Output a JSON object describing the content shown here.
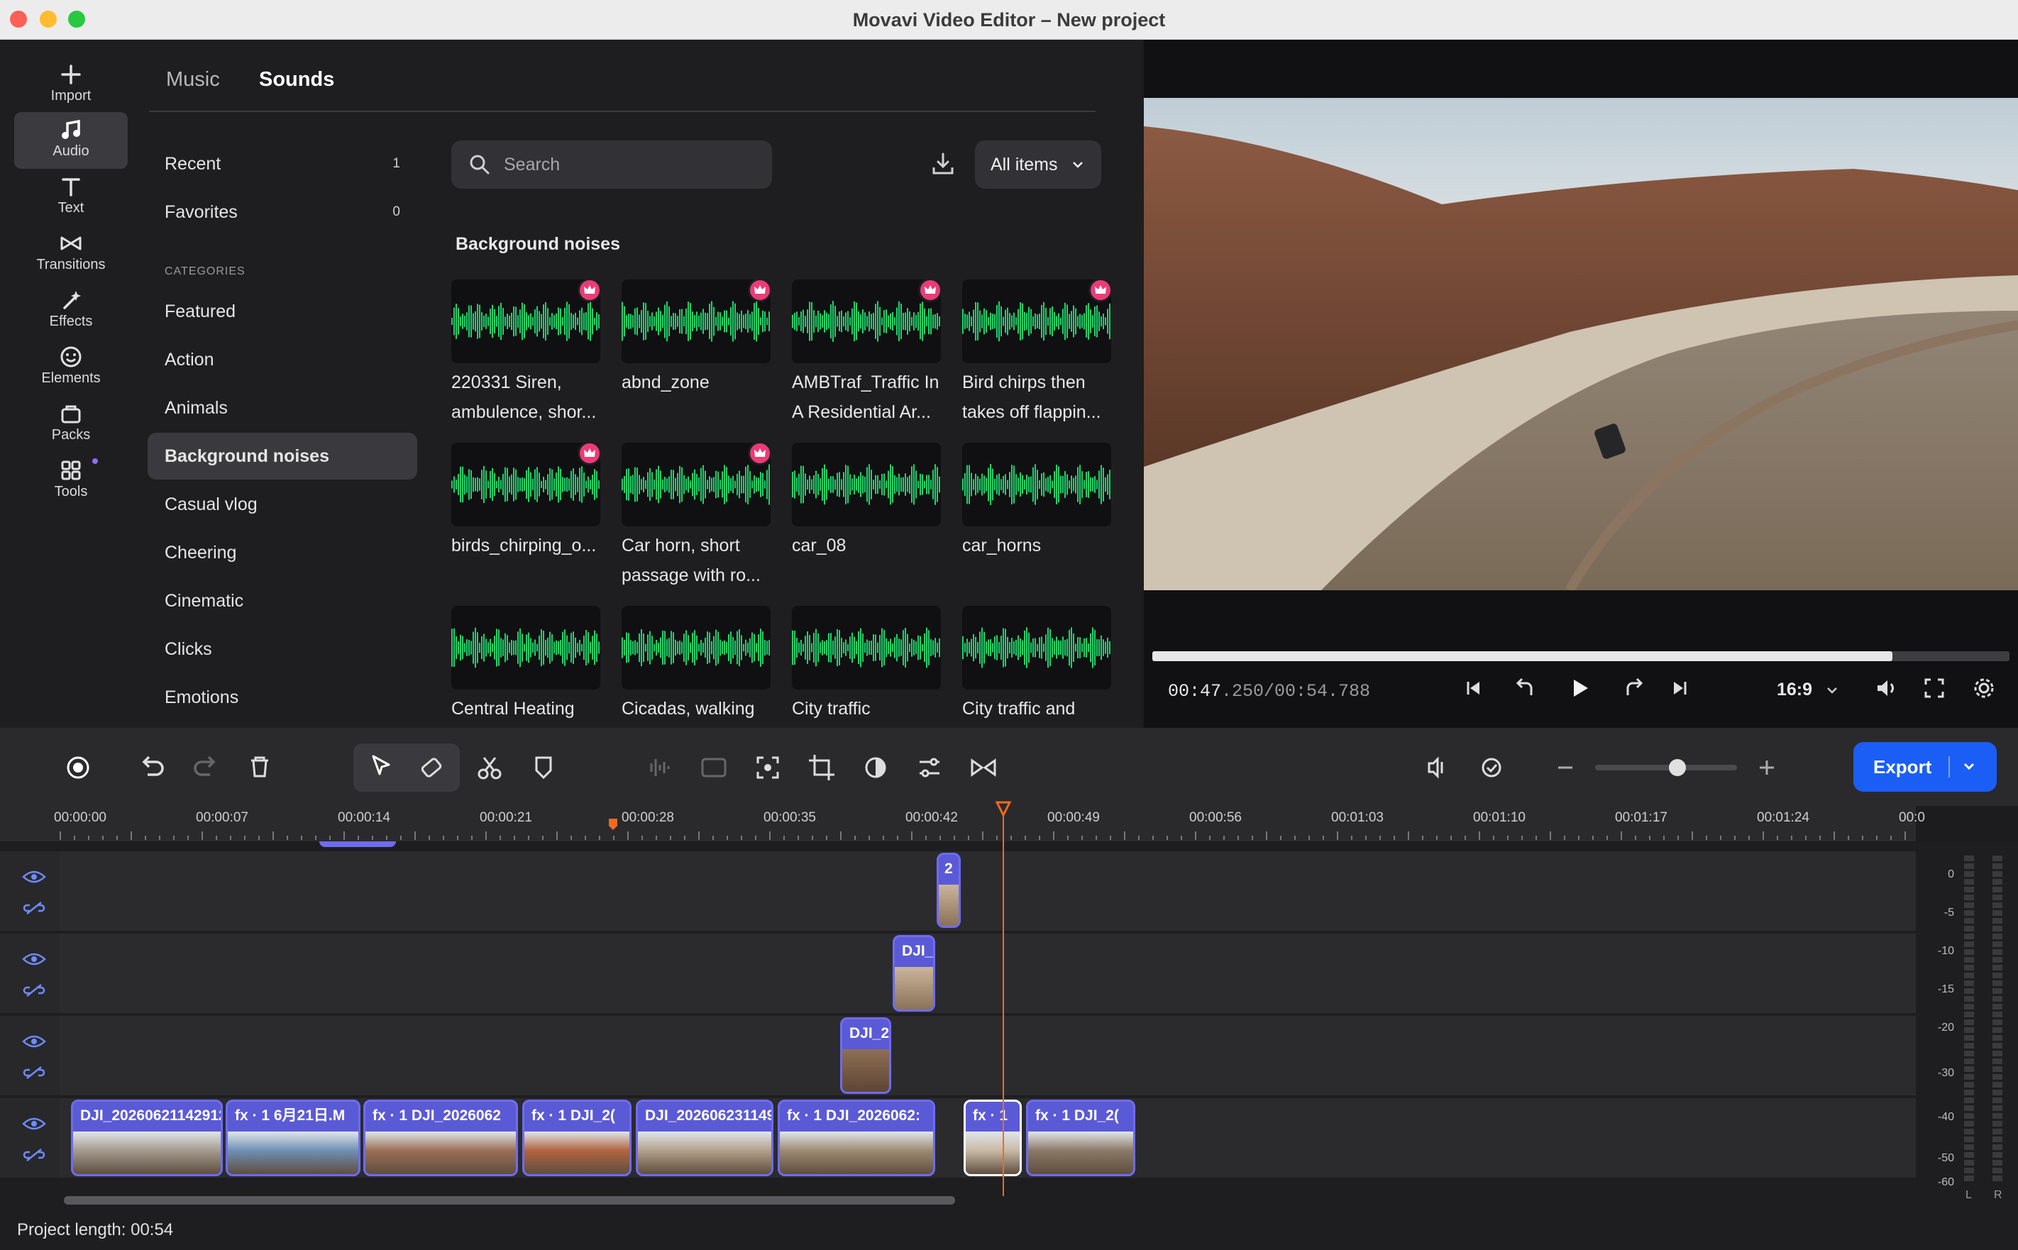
{
  "window": {
    "title": "Movavi Video Editor – New project"
  },
  "nav": {
    "items": [
      {
        "label": "Import"
      },
      {
        "label": "Audio"
      },
      {
        "label": "Text"
      },
      {
        "label": "Transitions"
      },
      {
        "label": "Effects"
      },
      {
        "label": "Elements"
      },
      {
        "label": "Packs"
      },
      {
        "label": "Tools"
      }
    ]
  },
  "library": {
    "tabs": [
      "Music",
      "Sounds"
    ],
    "active_tab": "Sounds",
    "recent": {
      "label": "Recent",
      "count": "1"
    },
    "favorites": {
      "label": "Favorites",
      "count": "0"
    },
    "categories_heading": "CATEGORIES",
    "categories": [
      "Featured",
      "Action",
      "Animals",
      "Background noises",
      "Casual vlog",
      "Cheering",
      "Cinematic",
      "Clicks",
      "Emotions"
    ],
    "active_category": "Background noises",
    "search_placeholder": "Search",
    "filter": "All items",
    "section_title": "Background noises",
    "sounds": [
      {
        "name": "220331 Siren, ambulence, shor...",
        "premium": true
      },
      {
        "name": "abnd_zone",
        "premium": true
      },
      {
        "name": "AMBTraf_Traffic In A Residential Ar...",
        "premium": true
      },
      {
        "name": "Bird chirps then takes off flappin...",
        "premium": true
      },
      {
        "name": "birds_chirping_o...",
        "premium": true
      },
      {
        "name": "Car horn, short passage with ro...",
        "premium": true
      },
      {
        "name": "car_08",
        "premium": false
      },
      {
        "name": "car_horns",
        "premium": false
      },
      {
        "name": "Central Heating",
        "premium": false
      },
      {
        "name": "Cicadas, walking",
        "premium": false
      },
      {
        "name": "City traffic",
        "premium": false
      },
      {
        "name": "City traffic and",
        "premium": false
      }
    ]
  },
  "player": {
    "time_current": "00:47",
    "time_current_ms": ".250",
    "time_total": "/00:54.788",
    "progress": 0.863,
    "aspect": "16:9"
  },
  "toolbar": {
    "export_label": "Export",
    "zoom_level": 0.58
  },
  "ruler": {
    "ticks": [
      "00:00:00",
      "00:00:07",
      "00:00:14",
      "00:00:21",
      "00:00:28",
      "00:00:35",
      "00:00:42",
      "00:00:49",
      "00:00:56",
      "00:01:03",
      "00:01:10",
      "00:01:17",
      "00:01:24",
      "00:0"
    ]
  },
  "timeline": {
    "clips_row1": [
      {
        "label": "2"
      }
    ],
    "clips_row2": [
      {
        "label": "DJI_"
      }
    ],
    "clips_row3": [
      {
        "label": "DJI_2"
      }
    ],
    "clips_main": [
      {
        "label": "DJI_20260621142912"
      },
      {
        "label": "fx · 1  6月21日.M"
      },
      {
        "label": "fx · 1  DJI_2026062"
      },
      {
        "label": "fx · 1  DJI_2("
      },
      {
        "label": "DJI_202606231149"
      },
      {
        "label": "fx · 1  DJI_2026062:"
      },
      {
        "label": "fx · 1"
      },
      {
        "label": "fx · 1  DJI_2("
      }
    ]
  },
  "meters": {
    "scale": [
      "0",
      "-5",
      "-10",
      "-15",
      "-20",
      "-30",
      "-40",
      "-50",
      "-60"
    ],
    "left": "L",
    "right": "R"
  },
  "status": {
    "project_length": "Project length: 00:54"
  },
  "colors": {
    "accent": "#1b5ef5",
    "clip": "#5b5ad6",
    "wave": "#1fd36b",
    "playhead": "#f06a23",
    "premium": "#ec3b77"
  }
}
